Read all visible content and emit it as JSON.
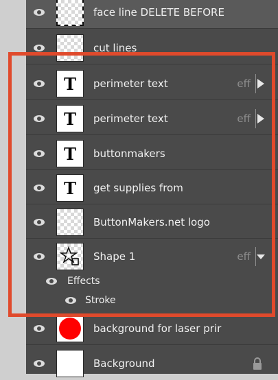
{
  "layers": [
    {
      "label": "face line DELETE BEFORE",
      "thumb": "dashed-checker",
      "eff": ""
    },
    {
      "label": "cut lines",
      "thumb": "checker",
      "eff": ""
    },
    {
      "label": "perimeter text",
      "thumb": "text",
      "thumb_glyph": "T",
      "eff": "eff",
      "arrow": "right"
    },
    {
      "label": "perimeter text",
      "thumb": "text",
      "thumb_glyph": "T",
      "eff": "eff",
      "arrow": "right"
    },
    {
      "label": "buttonmakers",
      "thumb": "text",
      "thumb_glyph": "T",
      "eff": ""
    },
    {
      "label": "get supplies from",
      "thumb": "text",
      "thumb_glyph": "T",
      "eff": ""
    },
    {
      "label": "ButtonMakers.net logo",
      "thumb": "checker",
      "eff": ""
    },
    {
      "label": "Shape 1",
      "thumb": "shape",
      "eff": "eff",
      "arrow": "down"
    },
    {
      "label": "background for laser prir",
      "thumb": "red-circle",
      "eff": ""
    },
    {
      "label": "Background",
      "thumb": "white",
      "eff": "",
      "locked": true
    }
  ],
  "effects": {
    "group_label": "Effects",
    "stroke_label": "Stroke"
  },
  "colors": {
    "panel": "#4a4a4a",
    "highlight": "#e04a2c",
    "red_thumb": "#ff0000"
  },
  "icons": [
    "eye-icon",
    "text-layer-icon",
    "shape-icon",
    "lock-icon",
    "arrow-right-icon",
    "arrow-down-icon"
  ]
}
